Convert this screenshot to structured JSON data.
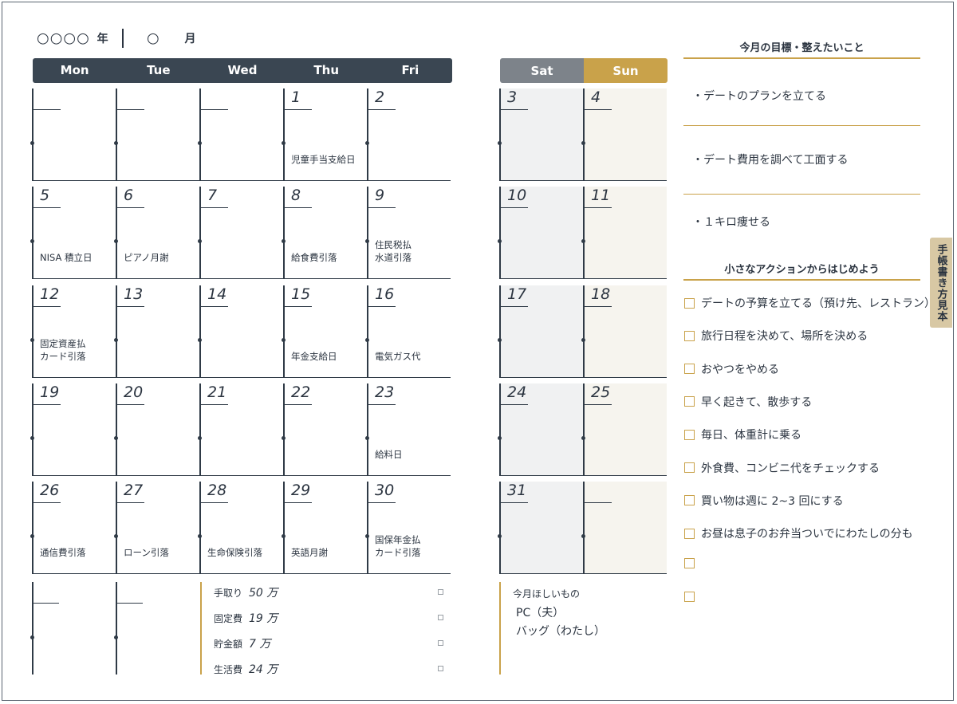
{
  "header": {
    "year_placeholder": "○○○○",
    "year_label": "年",
    "month_placeholder": "○",
    "month_label": "月"
  },
  "weekdays": [
    "Mon",
    "Tue",
    "Wed",
    "Thu",
    "Fri"
  ],
  "weekend": {
    "sat": "Sat",
    "sun": "Sun"
  },
  "weeks": [
    {
      "mon": {
        "day": "",
        "note": ""
      },
      "tue": {
        "day": "",
        "note": ""
      },
      "wed": {
        "day": "",
        "note": ""
      },
      "thu": {
        "day": "1",
        "note": "児童手当支給日"
      },
      "fri": {
        "day": "2",
        "note": ""
      },
      "sat": {
        "day": "3",
        "note": ""
      },
      "sun": {
        "day": "4",
        "note": ""
      }
    },
    {
      "mon": {
        "day": "5",
        "note": "NISA 積立日"
      },
      "tue": {
        "day": "6",
        "note": "ピアノ月謝"
      },
      "wed": {
        "day": "7",
        "note": ""
      },
      "thu": {
        "day": "8",
        "note": "給食費引落"
      },
      "fri": {
        "day": "9",
        "note": "住民税払\n水道引落"
      },
      "sat": {
        "day": "10",
        "note": ""
      },
      "sun": {
        "day": "11",
        "note": ""
      }
    },
    {
      "mon": {
        "day": "12",
        "note": "固定資産払\nカード引落"
      },
      "tue": {
        "day": "13",
        "note": ""
      },
      "wed": {
        "day": "14",
        "note": ""
      },
      "thu": {
        "day": "15",
        "note": "年金支給日"
      },
      "fri": {
        "day": "16",
        "note": "電気ガス代"
      },
      "sat": {
        "day": "17",
        "note": ""
      },
      "sun": {
        "day": "18",
        "note": ""
      }
    },
    {
      "mon": {
        "day": "19",
        "note": ""
      },
      "tue": {
        "day": "20",
        "note": ""
      },
      "wed": {
        "day": "21",
        "note": ""
      },
      "thu": {
        "day": "22",
        "note": ""
      },
      "fri": {
        "day": "23",
        "note": "給料日"
      },
      "sat": {
        "day": "24",
        "note": ""
      },
      "sun": {
        "day": "25",
        "note": ""
      }
    },
    {
      "mon": {
        "day": "26",
        "note": "通信費引落"
      },
      "tue": {
        "day": "27",
        "note": "ローン引落"
      },
      "wed": {
        "day": "28",
        "note": "生命保険引落"
      },
      "thu": {
        "day": "29",
        "note": "英語月謝"
      },
      "fri": {
        "day": "30",
        "note": "国保年金払\nカード引落"
      },
      "sat": {
        "day": "31",
        "note": ""
      },
      "sun": {
        "day": "",
        "note": ""
      }
    }
  ],
  "budget": [
    {
      "label": "手取り",
      "value": "50 万"
    },
    {
      "label": "固定費",
      "value": "19 万"
    },
    {
      "label": "貯金額",
      "value": "7 万"
    },
    {
      "label": "生活費",
      "value": "24 万"
    }
  ],
  "wishlist": {
    "title": "今月ほしいもの",
    "items": [
      "PC（夫）",
      "バッグ（わたし）"
    ]
  },
  "goals": {
    "title": "今月の目標・整えたいこと",
    "items": [
      "・デートのプランを立てる",
      "・デート費用を調べて工面する",
      "・１キロ痩せる"
    ]
  },
  "actions": {
    "title": "小さなアクションからはじめよう",
    "items": [
      "デートの予算を立てる（預け先、レストラン）",
      "旅行日程を決めて、場所を決める",
      "おやつをやめる",
      "早く起きて、散歩する",
      "毎日、体重計に乗る",
      "外食費、コンビニ代をチェックする",
      "買い物は週に 2~3 回にする",
      "お昼は息子のお弁当ついでにわたしの分も",
      "",
      ""
    ]
  },
  "side_tab": "手帳書き方見本",
  "colors": {
    "navy": "#3a4652",
    "gray": "#7d838a",
    "gold": "#c9a24a"
  }
}
